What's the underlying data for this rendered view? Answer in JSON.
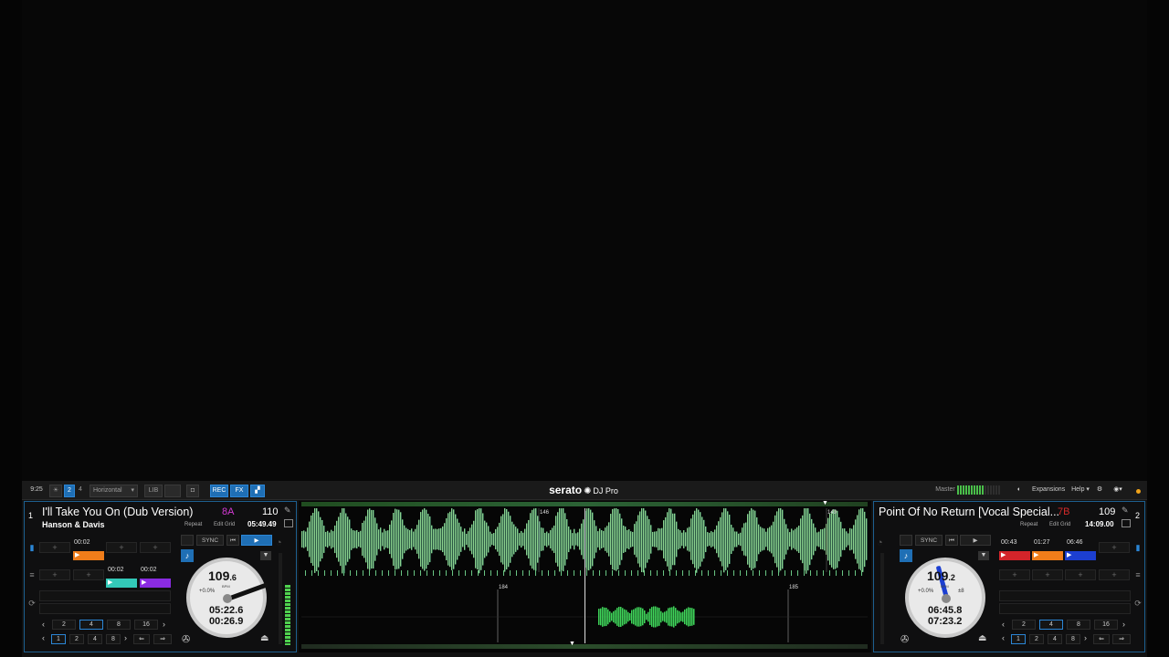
{
  "toolbar": {
    "clock": "9:25",
    "deck_mode_2": "2",
    "deck_mode_4": "4",
    "layout": "Horizontal",
    "lib": "LIB",
    "rec": "REC",
    "fx": "FX",
    "master": "Master",
    "expansions": "Expansions",
    "help": "Help"
  },
  "logo": {
    "brand": "serato",
    "product": "DJ Pro"
  },
  "deck1": {
    "number": "1",
    "title": "I'll Take You On (Dub Version)",
    "artist": "Hanson & Davis",
    "key": "8A",
    "key_color": "#d43ad4",
    "bpm": "110",
    "repeat": "Repeat",
    "edit_grid": "Edit Grid",
    "remaining_total": "05:49.49",
    "sync": "SYNC",
    "platter_bpm_big": "109",
    "platter_bpm_small": ".6",
    "platter_bpm_label": "BPM",
    "pitch": "+0.0%",
    "elapsed": "05:22.6",
    "remaining": "00:26.9",
    "cues": [
      {
        "time": "00:02",
        "color": "#f07d1a"
      },
      {
        "time": "00:02",
        "color": "#33c9b8"
      },
      {
        "time": "00:02",
        "color": "#8a2be2"
      }
    ],
    "loops_top": [
      "2",
      "4",
      "8",
      "16"
    ],
    "loops_bottom": [
      "1",
      "2",
      "4",
      "8"
    ]
  },
  "deck2": {
    "number": "2",
    "title": "Point Of No Return [Vocal Special...",
    "key": "7B",
    "key_color": "#d42a2a",
    "bpm": "109",
    "repeat": "Repeat",
    "edit_grid": "Edit Grid",
    "remaining_total": "14:09.00",
    "sync": "SYNC",
    "platter_bpm_big": "109",
    "platter_bpm_small": ".2",
    "platter_bpm_label": "BPM",
    "pitch": "+0.0%",
    "pitch_range": "±8",
    "elapsed": "06:45.8",
    "remaining": "07:23.2",
    "cues": [
      {
        "time": "00:43",
        "color": "#d4242a"
      },
      {
        "time": "01:27",
        "color": "#f07d1a"
      },
      {
        "time": "06:46",
        "color": "#1c3fd1"
      }
    ],
    "loops_top": [
      "2",
      "4",
      "8",
      "16"
    ],
    "loops_bottom": [
      "1",
      "2",
      "4",
      "8"
    ]
  },
  "waveform": {
    "bar_top_left": "146",
    "bar_top_right": "149",
    "bar_bottom_left": "184",
    "bar_bottom_right": "185"
  }
}
